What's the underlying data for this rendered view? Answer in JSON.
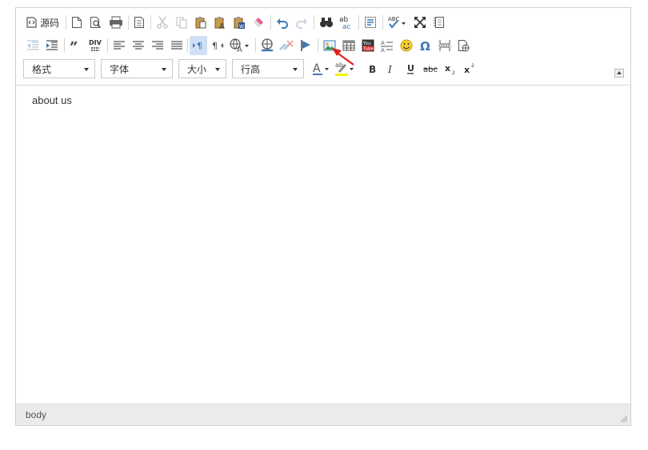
{
  "toolbar": {
    "source_label": "源码",
    "combos": {
      "format": "格式",
      "font": "字体",
      "size": "大小",
      "line_height": "行高"
    },
    "highlighted_button": "image"
  },
  "content": {
    "text": "about us"
  },
  "statusbar": {
    "path": "body"
  },
  "colors": {
    "accent_blue": "#3e78b4",
    "annotation_arrow": "#e51c1c",
    "active_bg": "#cfe0f5",
    "statusbar_bg": "#ebebeb"
  }
}
